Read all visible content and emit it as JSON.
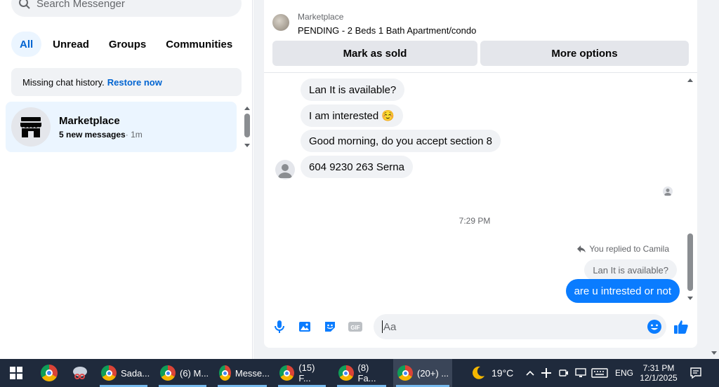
{
  "sidebar": {
    "search_placeholder": "Search Messenger",
    "filters": [
      "All",
      "Unread",
      "Groups",
      "Communities"
    ],
    "active_filter": "All",
    "notice": {
      "text": "Missing chat history.",
      "link": "Restore now"
    },
    "chat": {
      "name": "Marketplace",
      "unread": "5 new messages",
      "time": "· 1m"
    }
  },
  "listing": {
    "label": "Marketplace",
    "title": "PENDING - 2 Beds 1 Bath Apartment/condo",
    "mark_sold": "Mark as sold",
    "more_options": "More options"
  },
  "messages": {
    "incoming": [
      "Lan It is available?",
      "I am interested ☺️",
      "Good morning, do you accept section 8",
      "604 9230 263 Serna"
    ],
    "timestamp": "7:29 PM",
    "replied_label": "You replied to Camila",
    "quoted": "Lan It is available?",
    "outgoing": "are u intrested or not"
  },
  "composer": {
    "placeholder": "Aa"
  },
  "taskbar": {
    "apps": [
      "Sada...",
      "(6) M...",
      "Messe...",
      "(15) F...",
      "(8) Fa...",
      "(20+) ..."
    ],
    "weather": "19°C",
    "lang": "ENG",
    "time": "7:31 PM",
    "date": "12/1/2025"
  },
  "colors": {
    "accent": "#0064d1",
    "bubble_mine": "#0a7cff",
    "like": "#0a7cff"
  }
}
